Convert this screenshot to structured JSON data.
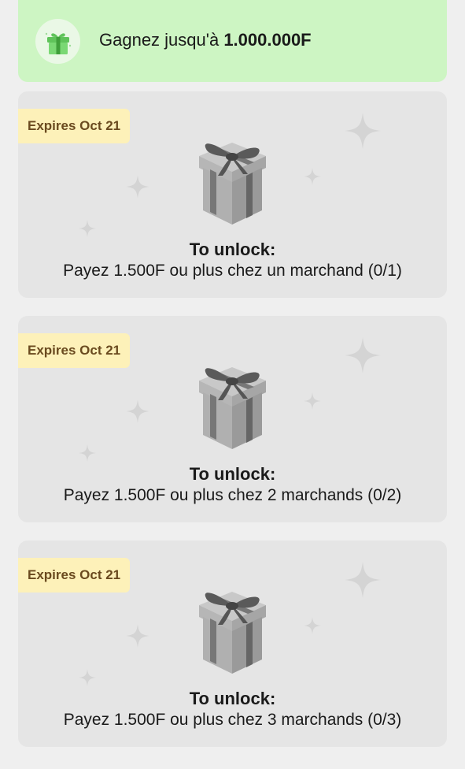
{
  "banner": {
    "icon": "green-gift-icon",
    "text_prefix": "Gagnez jusqu'à ",
    "text_amount": "1.000.000F",
    "accent_color": "#cdf5c3"
  },
  "rewards": [
    {
      "expires": "Expires Oct 21",
      "icon": "locked-gift-box-icon",
      "title": "To unlock:",
      "requirement": "Payez 1.500F ou plus chez un marchand (0/1)"
    },
    {
      "expires": "Expires Oct 21",
      "icon": "locked-gift-box-icon",
      "title": "To unlock:",
      "requirement": "Payez 1.500F ou plus chez 2 marchands (0/2)"
    },
    {
      "expires": "Expires Oct 21",
      "icon": "locked-gift-box-icon",
      "title": "To unlock:",
      "requirement": "Payez 1.500F ou plus chez 3 marchands (0/3)"
    }
  ],
  "colors": {
    "card_background": "#e5e5e5",
    "badge_background": "#fdf1b9",
    "badge_text": "#6a4a1f"
  }
}
